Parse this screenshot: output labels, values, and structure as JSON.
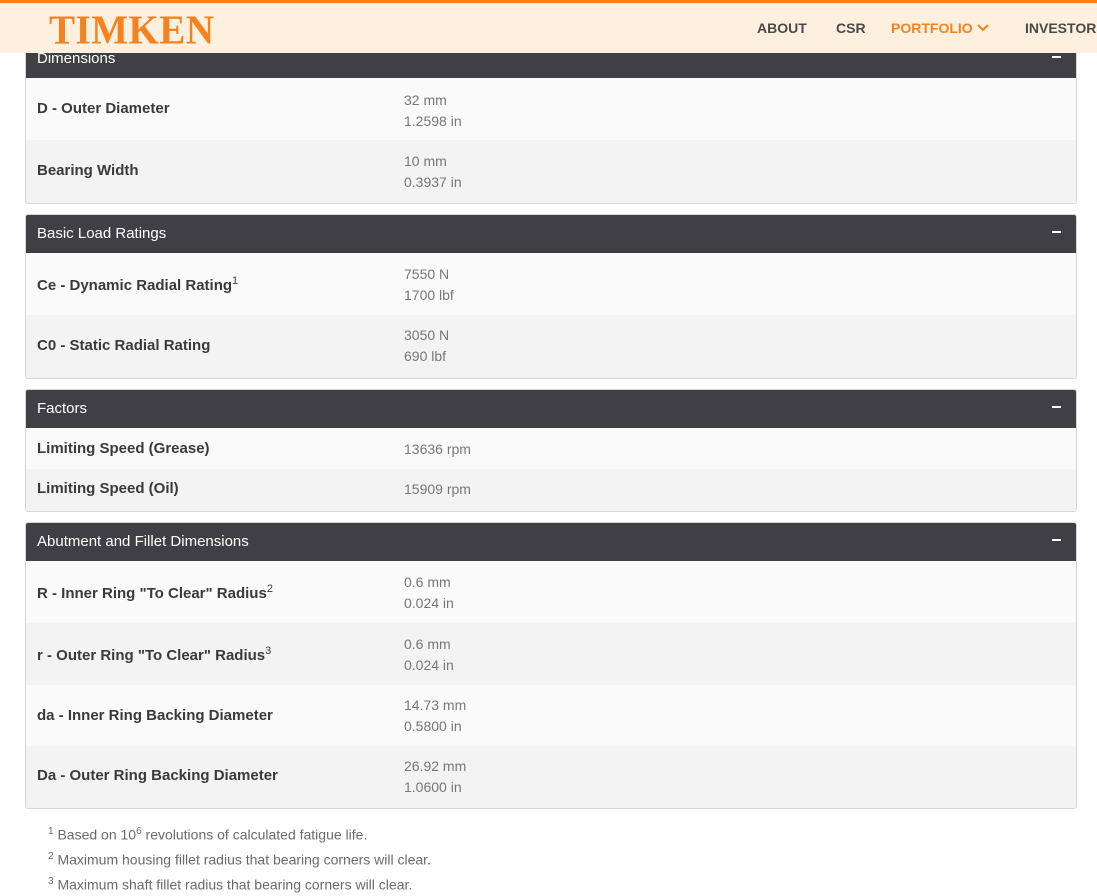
{
  "header": {
    "logo": "TIMKEN",
    "nav": [
      {
        "label": "ABOUT",
        "active": false
      },
      {
        "label": "CSR",
        "active": false
      },
      {
        "label": "PORTFOLIO",
        "active": true
      },
      {
        "label": "INVESTORS",
        "active": false
      }
    ],
    "brand_color": "#f5821f"
  },
  "sections": [
    {
      "title": "Dimensions",
      "toggle": "collapse",
      "rows": [
        {
          "label": "D - Outer Diameter",
          "sup": "",
          "values": [
            "32 mm",
            "1.2598 in"
          ]
        },
        {
          "label": "Bearing Width",
          "sup": "",
          "values": [
            "10 mm",
            "0.3937 in"
          ]
        }
      ]
    },
    {
      "title": "Basic Load Ratings",
      "toggle": "collapse",
      "rows": [
        {
          "label": "Ce - Dynamic Radial Rating",
          "sup": "1",
          "values": [
            "7550 N",
            "1700 lbf"
          ]
        },
        {
          "label": "C0 - Static Radial Rating",
          "sup": "",
          "values": [
            "3050 N",
            "690 lbf"
          ]
        }
      ]
    },
    {
      "title": "Factors",
      "toggle": "collapse",
      "rows": [
        {
          "label": "Limiting Speed (Grease)",
          "sup": "",
          "values": [
            "13636 rpm"
          ]
        },
        {
          "label": "Limiting Speed (Oil)",
          "sup": "",
          "values": [
            "15909 rpm"
          ]
        }
      ]
    },
    {
      "title": "Abutment and Fillet Dimensions",
      "toggle": "collapse",
      "rows": [
        {
          "label": "R - Inner Ring \"To Clear\" Radius",
          "sup": "2",
          "values": [
            "0.6 mm",
            "0.024 in"
          ]
        },
        {
          "label": "r - Outer Ring \"To Clear\" Radius",
          "sup": "3",
          "values": [
            "0.6 mm",
            "0.024 in"
          ]
        },
        {
          "label": "da - Inner Ring Backing Diameter",
          "sup": "",
          "values": [
            "14.73 mm",
            "0.5800 in"
          ]
        },
        {
          "label": "Da - Outer Ring Backing Diameter",
          "sup": "",
          "values": [
            "26.92 mm",
            "1.0600 in"
          ]
        }
      ]
    }
  ],
  "footnotes": [
    {
      "num": "1",
      "text_before": "Based on 10",
      "sup": "6",
      "text_after": " revolutions of calculated fatigue life."
    },
    {
      "num": "2",
      "text_before": "Maximum housing fillet radius that bearing corners will clear.",
      "sup": "",
      "text_after": ""
    },
    {
      "num": "3",
      "text_before": "Maximum shaft fillet radius that bearing corners will clear.",
      "sup": "",
      "text_after": ""
    }
  ]
}
